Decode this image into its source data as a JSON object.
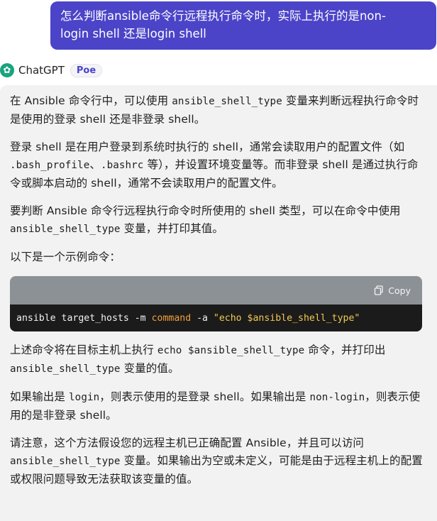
{
  "user_message": {
    "line1": "怎么判断ansible命令行远程执行命令时，实际上执行的是non-",
    "line2": "login shell 还是login shell"
  },
  "bot": {
    "name": "ChatGPT",
    "badge": "Poe",
    "logo_icon": "chatgpt-logo-icon"
  },
  "response": {
    "p1": {
      "a": "在 Ansible 命令行中，可以使用 ",
      "code": "ansible_shell_type",
      "b": " 变量来判断远程执行命令时是使用的登录 shell 还是非登录 shell。"
    },
    "p2": {
      "a": "登录 shell 是在用户登录到系统时执行的 shell，通常会读取用户的配置文件（如 ",
      "code1": ".bash_profile",
      "sep": "、",
      "code2": ".bashrc",
      "b": " 等），并设置环境变量等。而非登录 shell 是通过执行命令或脚本启动的 shell，通常不会读取用户的配置文件。"
    },
    "p3": {
      "a": "要判断 Ansible 命令行远程执行命令时所使用的 shell 类型，可以在命令中使用 ",
      "code": "ansible_shell_type",
      "b": " 变量，并打印其值。"
    },
    "p4": "以下是一个示例命令：",
    "code_block": {
      "copy_label": "Copy",
      "t1": "ansible target_hosts -m ",
      "t2": "command",
      "t3": " -a ",
      "t4": "\"echo $ansible_shell_type\""
    },
    "p5": {
      "a": "上述命令将在目标主机上执行 ",
      "code1": "echo $ansible_shell_type",
      "b": " 命令，并打印出 ",
      "code2": "ansible_shell_type",
      "c": " 变量的值。"
    },
    "p6": {
      "a": "如果输出是 ",
      "code1": "login",
      "b": "，则表示使用的是登录 shell。如果输出是 ",
      "code2": "non-login",
      "c": "，则表示使用的是非登录 shell。"
    },
    "p7": {
      "a": "请注意，这个方法假设您的远程主机已正确配置 Ansible，并且可以访问 ",
      "code": "ansible_shell_type",
      "b": " 变量。如果输出为空或未定义，可能是由于远程主机上的配置或权限问题导致无法获取该变量的值。"
    }
  },
  "colors": {
    "user_bubble": "#4b44c8",
    "bot_bubble": "#f2f2f3",
    "code_header": "#8c9196",
    "code_body": "#1b1b1b"
  }
}
